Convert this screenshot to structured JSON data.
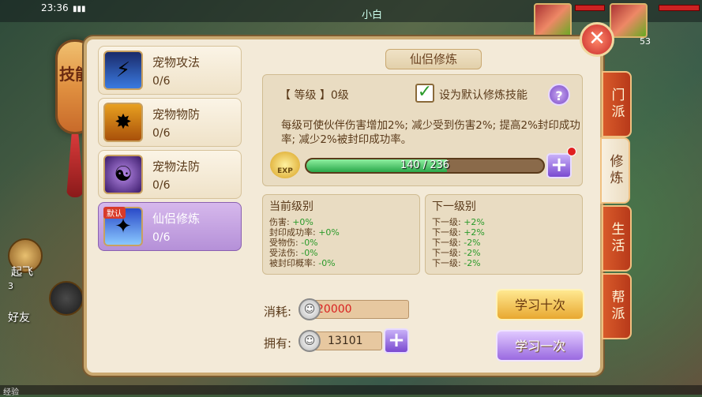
{
  "status": {
    "time": "23:36",
    "map": "小白"
  },
  "left_ui": {
    "lantern_text": "技能",
    "fly_label": "起飞",
    "chat_label": "3",
    "friends_label": "好友",
    "exp_label": "经验"
  },
  "skills": [
    {
      "name": "宠物攻法",
      "progress": "0/6",
      "icon": "pet-attack-icon"
    },
    {
      "name": "宠物物防",
      "progress": "0/6",
      "icon": "pet-physical-defense-icon"
    },
    {
      "name": "宠物法防",
      "progress": "0/6",
      "icon": "pet-magic-defense-icon"
    },
    {
      "name": "仙侣修炼",
      "progress": "0/6",
      "icon": "companion-training-icon",
      "tag": "默认",
      "selected": true
    }
  ],
  "detail": {
    "title": "仙侣修炼",
    "grade_label": "【 等级 】0级",
    "default_label": "设为默认修炼技能",
    "help": "?",
    "description": "每级可使伙伴伤害增加2%; 减少受到伤害2%; 提高2%封印成功率; 减少2%被封印成功率。",
    "exp_icon": "EXP",
    "exp_text": "140 / 236",
    "exp_fraction": 0.593
  },
  "current": {
    "title": "当前级别",
    "rows": [
      {
        "k": "伤害:",
        "v": "+0%"
      },
      {
        "k": "封印成功率:",
        "v": "+0%"
      },
      {
        "k": "受物伤:",
        "v": "-0%"
      },
      {
        "k": "受法伤:",
        "v": "-0%"
      },
      {
        "k": "被封印概率:",
        "v": "-0%"
      }
    ]
  },
  "next": {
    "title": "下一级别",
    "rows": [
      {
        "k": "下一级:",
        "v": "+2%"
      },
      {
        "k": "下一级:",
        "v": "+2%"
      },
      {
        "k": "下一级:",
        "v": "-2%"
      },
      {
        "k": "下一级:",
        "v": "-2%"
      },
      {
        "k": "下一级:",
        "v": "-2%"
      }
    ]
  },
  "cost": {
    "label": "消耗:",
    "value": "20000",
    "color": "#d82020"
  },
  "own": {
    "label": "拥有:",
    "value": "13101"
  },
  "buttons": {
    "learn_ten": "学习十次",
    "learn_one": "学习一次",
    "close": "✕",
    "plus": "+"
  },
  "tabs": [
    "门派",
    "修炼",
    "生活",
    "帮派"
  ],
  "top_right": {
    "level": "53"
  }
}
